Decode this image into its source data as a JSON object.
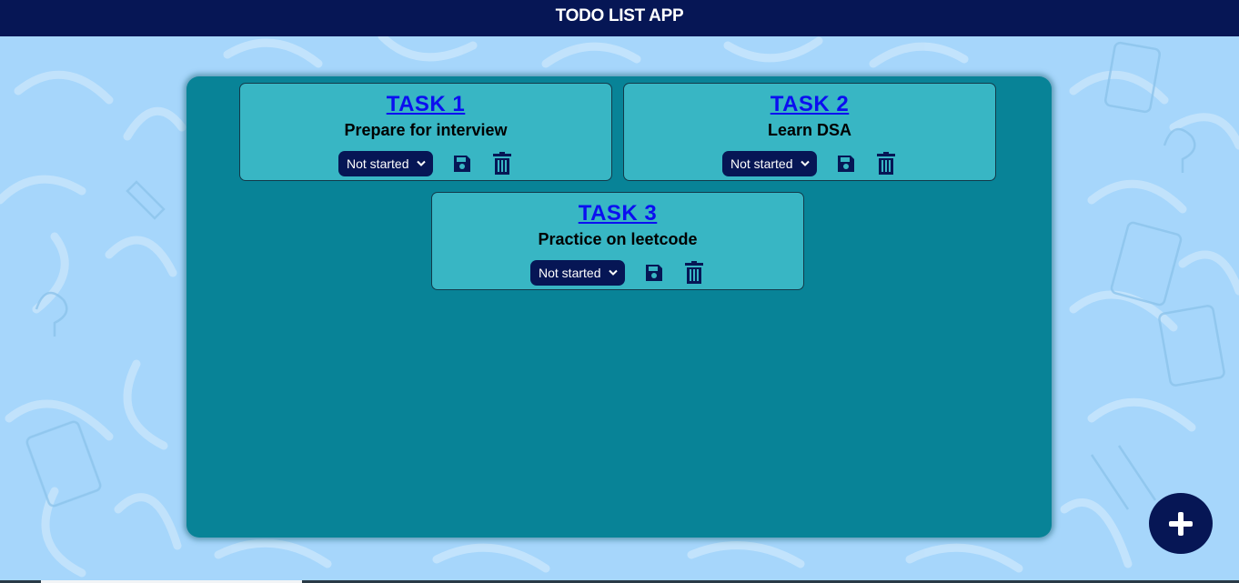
{
  "app": {
    "title": "TODO LIST APP"
  },
  "tasks": [
    {
      "title": "TASK 1",
      "description": "Prepare for interview",
      "status": "Not started"
    },
    {
      "title": "TASK 2",
      "description": "Learn DSA",
      "status": "Not started"
    },
    {
      "title": "TASK 3",
      "description": "Practice on leetcode",
      "status": "Not started"
    }
  ],
  "icons": {
    "save": "floppy-disk-icon",
    "delete": "trash-icon",
    "add": "plus-icon",
    "dropdown": "chevron-down-icon"
  },
  "colors": {
    "header_bg": "#061655",
    "page_bg": "#a6d6fb",
    "board_bg": "#088397",
    "card_bg": "#38b6c4",
    "title_link": "#0b0ff0",
    "icon_color": "#061655"
  }
}
